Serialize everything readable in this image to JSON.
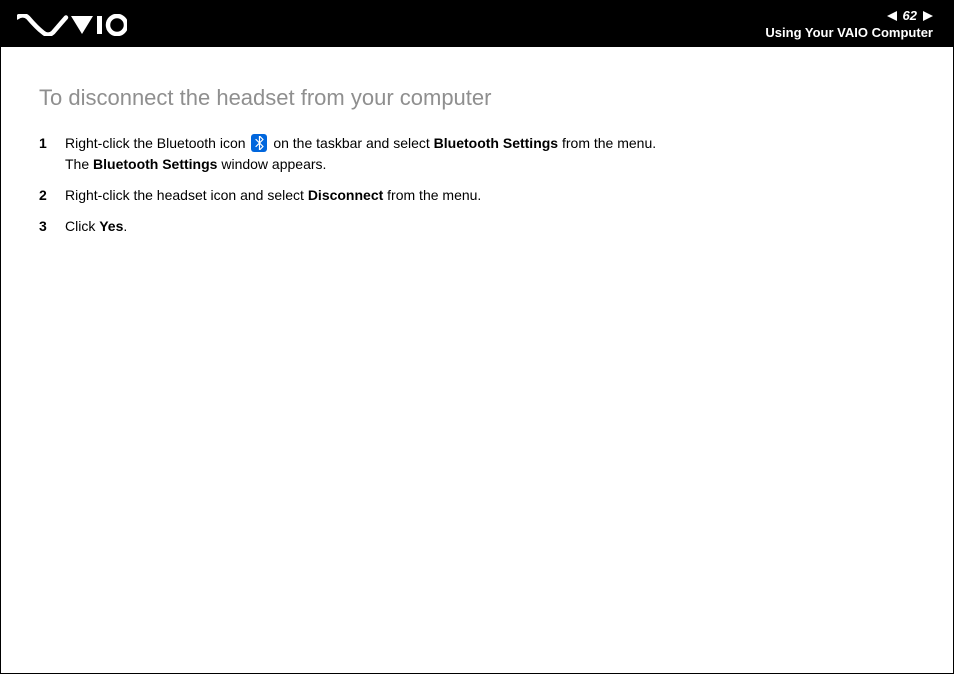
{
  "header": {
    "page_number": "62",
    "section": "Using Your VAIO Computer"
  },
  "content": {
    "heading": "To disconnect the headset from your computer",
    "steps": [
      {
        "num": "1",
        "parts": {
          "a": "Right-click the Bluetooth icon ",
          "b": " on the taskbar and select ",
          "c": "Bluetooth Settings",
          "d": " from the menu.",
          "e": "The ",
          "f": "Bluetooth Settings",
          "g": " window appears."
        }
      },
      {
        "num": "2",
        "parts": {
          "a": "Right-click the headset icon and select ",
          "b": "Disconnect",
          "c": " from the menu."
        }
      },
      {
        "num": "3",
        "parts": {
          "a": "Click ",
          "b": "Yes",
          "c": "."
        }
      }
    ]
  }
}
